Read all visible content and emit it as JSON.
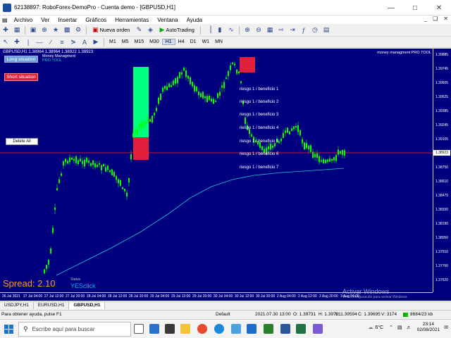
{
  "window": {
    "title": "62138897: RoboForex-DemoPro - Cuenta demo - [GBPUSD,H1]"
  },
  "menu": [
    "Archivo",
    "Ver",
    "Insertar",
    "Gráficos",
    "Herramientas",
    "Ventana",
    "Ayuda"
  ],
  "toolbar": {
    "new_order": "Nueva orden",
    "autotrading": "AutoTrading",
    "timeframes": [
      "M1",
      "M5",
      "M15",
      "M30",
      "H1",
      "H4",
      "D1",
      "W1",
      "MN"
    ],
    "active_timeframe": "H1"
  },
  "chart": {
    "header": "GBPUSD,H1  1.38964 1.38964 1.38922 1.38923",
    "money_management_label": "Money Managment",
    "tool_label": "PRO   TOOL",
    "money_management_pro": "money managment PRO TOOL",
    "long_button": "Long situation",
    "short_button": "Short situation",
    "delete_button": "Delete All",
    "riesgo_lines": [
      "riesgo 1 / beneficio 1",
      "riesgo 1 / beneficio 2",
      "riesgo 1 / beneficio 3",
      "riesgo 1 / beneficio 4",
      "riesgo 1 / beneficio 5",
      "riesgo 1 / beneficio 6",
      "riesgo 1 / beneficio 7"
    ],
    "spread": "Spread: 2.10",
    "status_small": "Status",
    "yesclick": "YESclick",
    "current_price": "1.38923",
    "y_labels": [
      "1.39885",
      "1.39745",
      "1.39605",
      "1.39525",
      "1.39385",
      "1.39245",
      "1.39105",
      "1.38965",
      "1.38750",
      "1.38610",
      "1.38470",
      "1.38330",
      "1.38190",
      "1.38050",
      "1.37910",
      "1.37760",
      "1.37620"
    ],
    "x_labels": [
      "26 Jul 2021",
      "27 Jul 04:00",
      "27 Jul 12:00",
      "27 Jul 20:00",
      "28 Jul 04:00",
      "28 Jul 12:00",
      "28 Jul 20:00",
      "29 Jul 04:00",
      "29 Jul 12:00",
      "29 Jul 20:00",
      "30 Jul 04:00",
      "30 Jul 12:00",
      "30 Jul 20:00",
      "2 Aug 04:00",
      "2 Aug 12:00",
      "2 Aug 20:00",
      "3 Aug 04:00"
    ],
    "watermark_title": "Activar Windows",
    "watermark_sub": "Ve a Configuración para activar Windows."
  },
  "chart_tabs": [
    "USDJPY,H1",
    "EURUSD,H1",
    "GBPUSD,H1"
  ],
  "active_chart_tab": "GBPUSD,H1",
  "statusbar": {
    "help": "Para obtener ayuda, pulse F1",
    "profile": "Default",
    "datetime": "2021.07.30 13:00",
    "open": "O: 1.39731",
    "high": "H: 1.39781",
    "low": "L: 1.39594",
    "close": "C: 1.39695",
    "volume": "V: 3174",
    "traffic": "8684/23 kb"
  },
  "taskbar": {
    "search_placeholder": "Escribe aquí para buscar",
    "weather": "6°C",
    "time": "23:14",
    "date": "02/08/2021"
  },
  "colors": {
    "chart_bg": "#00007f",
    "candle": "#00ff00",
    "ma_line": "#20c8c8",
    "price_line": "#ff2020",
    "long_zone": "#00ff7f",
    "short_zone": "#e0203c"
  }
}
